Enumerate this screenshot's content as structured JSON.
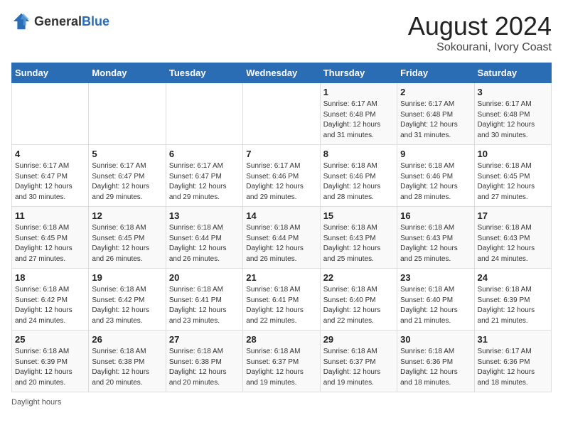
{
  "header": {
    "logo_general": "General",
    "logo_blue": "Blue",
    "title": "August 2024",
    "subtitle": "Sokourani, Ivory Coast"
  },
  "days_of_week": [
    "Sunday",
    "Monday",
    "Tuesday",
    "Wednesday",
    "Thursday",
    "Friday",
    "Saturday"
  ],
  "weeks": [
    [
      {
        "day": "",
        "info": ""
      },
      {
        "day": "",
        "info": ""
      },
      {
        "day": "",
        "info": ""
      },
      {
        "day": "",
        "info": ""
      },
      {
        "day": "1",
        "info": "Sunrise: 6:17 AM\nSunset: 6:48 PM\nDaylight: 12 hours\nand 31 minutes."
      },
      {
        "day": "2",
        "info": "Sunrise: 6:17 AM\nSunset: 6:48 PM\nDaylight: 12 hours\nand 31 minutes."
      },
      {
        "day": "3",
        "info": "Sunrise: 6:17 AM\nSunset: 6:48 PM\nDaylight: 12 hours\nand 30 minutes."
      }
    ],
    [
      {
        "day": "4",
        "info": "Sunrise: 6:17 AM\nSunset: 6:47 PM\nDaylight: 12 hours\nand 30 minutes."
      },
      {
        "day": "5",
        "info": "Sunrise: 6:17 AM\nSunset: 6:47 PM\nDaylight: 12 hours\nand 29 minutes."
      },
      {
        "day": "6",
        "info": "Sunrise: 6:17 AM\nSunset: 6:47 PM\nDaylight: 12 hours\nand 29 minutes."
      },
      {
        "day": "7",
        "info": "Sunrise: 6:17 AM\nSunset: 6:46 PM\nDaylight: 12 hours\nand 29 minutes."
      },
      {
        "day": "8",
        "info": "Sunrise: 6:18 AM\nSunset: 6:46 PM\nDaylight: 12 hours\nand 28 minutes."
      },
      {
        "day": "9",
        "info": "Sunrise: 6:18 AM\nSunset: 6:46 PM\nDaylight: 12 hours\nand 28 minutes."
      },
      {
        "day": "10",
        "info": "Sunrise: 6:18 AM\nSunset: 6:45 PM\nDaylight: 12 hours\nand 27 minutes."
      }
    ],
    [
      {
        "day": "11",
        "info": "Sunrise: 6:18 AM\nSunset: 6:45 PM\nDaylight: 12 hours\nand 27 minutes."
      },
      {
        "day": "12",
        "info": "Sunrise: 6:18 AM\nSunset: 6:45 PM\nDaylight: 12 hours\nand 26 minutes."
      },
      {
        "day": "13",
        "info": "Sunrise: 6:18 AM\nSunset: 6:44 PM\nDaylight: 12 hours\nand 26 minutes."
      },
      {
        "day": "14",
        "info": "Sunrise: 6:18 AM\nSunset: 6:44 PM\nDaylight: 12 hours\nand 26 minutes."
      },
      {
        "day": "15",
        "info": "Sunrise: 6:18 AM\nSunset: 6:43 PM\nDaylight: 12 hours\nand 25 minutes."
      },
      {
        "day": "16",
        "info": "Sunrise: 6:18 AM\nSunset: 6:43 PM\nDaylight: 12 hours\nand 25 minutes."
      },
      {
        "day": "17",
        "info": "Sunrise: 6:18 AM\nSunset: 6:43 PM\nDaylight: 12 hours\nand 24 minutes."
      }
    ],
    [
      {
        "day": "18",
        "info": "Sunrise: 6:18 AM\nSunset: 6:42 PM\nDaylight: 12 hours\nand 24 minutes."
      },
      {
        "day": "19",
        "info": "Sunrise: 6:18 AM\nSunset: 6:42 PM\nDaylight: 12 hours\nand 23 minutes."
      },
      {
        "day": "20",
        "info": "Sunrise: 6:18 AM\nSunset: 6:41 PM\nDaylight: 12 hours\nand 23 minutes."
      },
      {
        "day": "21",
        "info": "Sunrise: 6:18 AM\nSunset: 6:41 PM\nDaylight: 12 hours\nand 22 minutes."
      },
      {
        "day": "22",
        "info": "Sunrise: 6:18 AM\nSunset: 6:40 PM\nDaylight: 12 hours\nand 22 minutes."
      },
      {
        "day": "23",
        "info": "Sunrise: 6:18 AM\nSunset: 6:40 PM\nDaylight: 12 hours\nand 21 minutes."
      },
      {
        "day": "24",
        "info": "Sunrise: 6:18 AM\nSunset: 6:39 PM\nDaylight: 12 hours\nand 21 minutes."
      }
    ],
    [
      {
        "day": "25",
        "info": "Sunrise: 6:18 AM\nSunset: 6:39 PM\nDaylight: 12 hours\nand 20 minutes."
      },
      {
        "day": "26",
        "info": "Sunrise: 6:18 AM\nSunset: 6:38 PM\nDaylight: 12 hours\nand 20 minutes."
      },
      {
        "day": "27",
        "info": "Sunrise: 6:18 AM\nSunset: 6:38 PM\nDaylight: 12 hours\nand 20 minutes."
      },
      {
        "day": "28",
        "info": "Sunrise: 6:18 AM\nSunset: 6:37 PM\nDaylight: 12 hours\nand 19 minutes."
      },
      {
        "day": "29",
        "info": "Sunrise: 6:18 AM\nSunset: 6:37 PM\nDaylight: 12 hours\nand 19 minutes."
      },
      {
        "day": "30",
        "info": "Sunrise: 6:18 AM\nSunset: 6:36 PM\nDaylight: 12 hours\nand 18 minutes."
      },
      {
        "day": "31",
        "info": "Sunrise: 6:17 AM\nSunset: 6:36 PM\nDaylight: 12 hours\nand 18 minutes."
      }
    ]
  ],
  "footer": "Daylight hours"
}
